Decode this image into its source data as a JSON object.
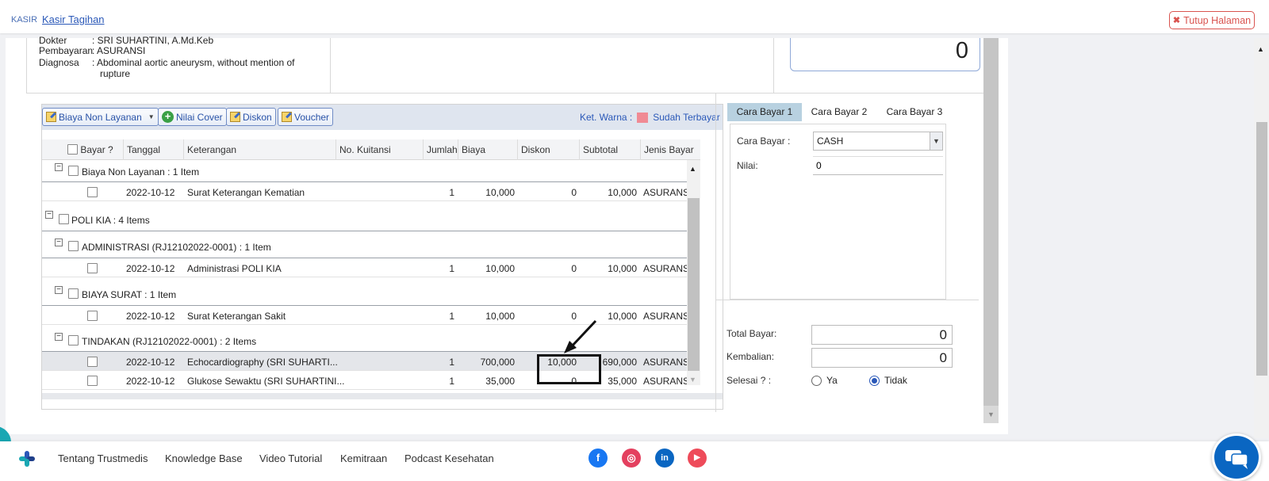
{
  "header": {
    "breadcrumb_root": "KASIR",
    "breadcrumb_current": "Kasir Tagihan",
    "close_button": "Tutup Halaman"
  },
  "patient": {
    "dokter_label": "Dokter",
    "dokter_value": ": SRI SUHARTINI, A.Md.Keb",
    "pembayaran_label": "Pembayaran",
    "pembayaran_value": ": ASURANSI",
    "diagnosa_label": "Diagnosa",
    "diagnosa_value_1": ": Abdominal aortic aneurysm, without mention of",
    "diagnosa_value_2": "rupture",
    "total_display": "0"
  },
  "toolbar": {
    "biaya_non_layanan": "Biaya Non Layanan",
    "nilai_cover": "Nilai Cover",
    "diskon": "Diskon",
    "voucher": "Voucher",
    "ket_warna": "Ket. Warna :",
    "sudah_terbayar": "Sudah Terbayar",
    "sudah_terbayar_color": "#f08a94"
  },
  "table": {
    "headers": {
      "bayar": "Bayar ?",
      "tanggal": "Tanggal",
      "keterangan": "Keterangan",
      "no_kuitansi": "No. Kuitansi",
      "jumlah": "Jumlah",
      "biaya": "Biaya",
      "diskon": "Diskon",
      "subtotal": "Subtotal",
      "jenis_bayar": "Jenis Bayar"
    },
    "groups": [
      {
        "label": "Biaya Non Layanan : 1 Item"
      },
      {
        "label": "POLI KIA : 4 Items"
      },
      {
        "label": "ADMINISTRASI (RJ12102022-0001) : 1 Item"
      },
      {
        "label": "BIAYA SURAT : 1 Item"
      },
      {
        "label": "TINDAKAN (RJ12102022-0001) : 2 Items"
      }
    ],
    "rows": [
      {
        "tanggal": "2022-10-12",
        "keterangan": "Surat Keterangan Kematian",
        "jumlah": "1",
        "biaya": "10,000",
        "diskon": "0",
        "subtotal": "10,000",
        "jenis": "ASURANSI"
      },
      {
        "tanggal": "2022-10-12",
        "keterangan": "Administrasi POLI KIA",
        "jumlah": "1",
        "biaya": "10,000",
        "diskon": "0",
        "subtotal": "10,000",
        "jenis": "ASURANSI"
      },
      {
        "tanggal": "2022-10-12",
        "keterangan": "Surat Keterangan Sakit",
        "jumlah": "1",
        "biaya": "10,000",
        "diskon": "0",
        "subtotal": "10,000",
        "jenis": "ASURANSI"
      },
      {
        "tanggal": "2022-10-12",
        "keterangan": "Echocardiography (SRI SUHARTI...",
        "jumlah": "1",
        "biaya": "700,000",
        "diskon": "10,000",
        "subtotal": "690,000",
        "jenis": "ASURANSI"
      },
      {
        "tanggal": "2022-10-12",
        "keterangan": "Glukose Sewaktu (SRI SUHARTINI...",
        "jumlah": "1",
        "biaya": "35,000",
        "diskon": "0",
        "subtotal": "35,000",
        "jenis": "ASURANSI"
      }
    ]
  },
  "payment": {
    "tabs": [
      "Cara Bayar 1",
      "Cara Bayar 2",
      "Cara Bayar 3"
    ],
    "cara_bayar_label": "Cara Bayar :",
    "cara_bayar_value": "CASH",
    "nilai_label": "Nilai:",
    "nilai_value": "0",
    "total_bayar_label": "Total Bayar:",
    "total_bayar_value": "0",
    "kembalian_label": "Kembalian:",
    "kembalian_value": "0",
    "selesai_label": "Selesai ? :",
    "opt_ya": "Ya",
    "opt_tidak": "Tidak"
  },
  "footer": {
    "links": [
      "Tentang Trustmedis",
      "Knowledge Base",
      "Video Tutorial",
      "Kemitraan",
      "Podcast Kesehatan"
    ],
    "social_icons": [
      "facebook-icon",
      "instagram-icon",
      "linkedin-icon",
      "youtube-icon"
    ],
    "colors": {
      "facebook": "#1877f2",
      "instagram": "#e4405f",
      "linkedin": "#0a66c2",
      "youtube": "#ee4b5a"
    }
  }
}
